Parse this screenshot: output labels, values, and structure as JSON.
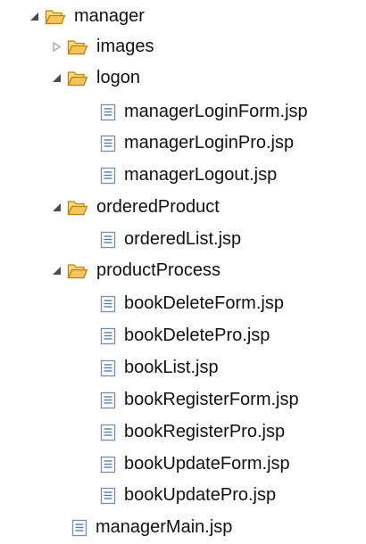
{
  "tree": {
    "root": {
      "label": "manager",
      "icon": "folder-open-icon",
      "expanded": true
    },
    "images": {
      "label": "images",
      "icon": "folder-closed-icon",
      "expanded": false
    },
    "logon": {
      "label": "logon",
      "icon": "folder-open-icon",
      "expanded": true,
      "files": [
        "managerLoginForm.jsp",
        "managerLoginPro.jsp",
        "managerLogout.jsp"
      ]
    },
    "orderedProduct": {
      "label": "orderedProduct",
      "icon": "folder-open-icon",
      "expanded": true,
      "files": [
        "orderedList.jsp"
      ]
    },
    "productProcess": {
      "label": "productProcess",
      "icon": "folder-open-icon",
      "expanded": true,
      "files": [
        "bookDeleteForm.jsp",
        "bookDeletePro.jsp",
        "bookList.jsp",
        "bookRegisterForm.jsp",
        "bookRegisterPro.jsp",
        "bookUpdateForm.jsp",
        "bookUpdatePro.jsp"
      ]
    },
    "managerMain": {
      "label": "managerMain.jsp",
      "icon": "jsp-file-icon"
    }
  },
  "colors": {
    "folder_fill": "#F3C55B",
    "folder_stroke": "#B8860B",
    "file_stroke": "#7A8CA5",
    "file_lines": "#5B7BA8",
    "toggle": "#4A4A4A",
    "toggle_collapsed": "#9A9A9A"
  }
}
